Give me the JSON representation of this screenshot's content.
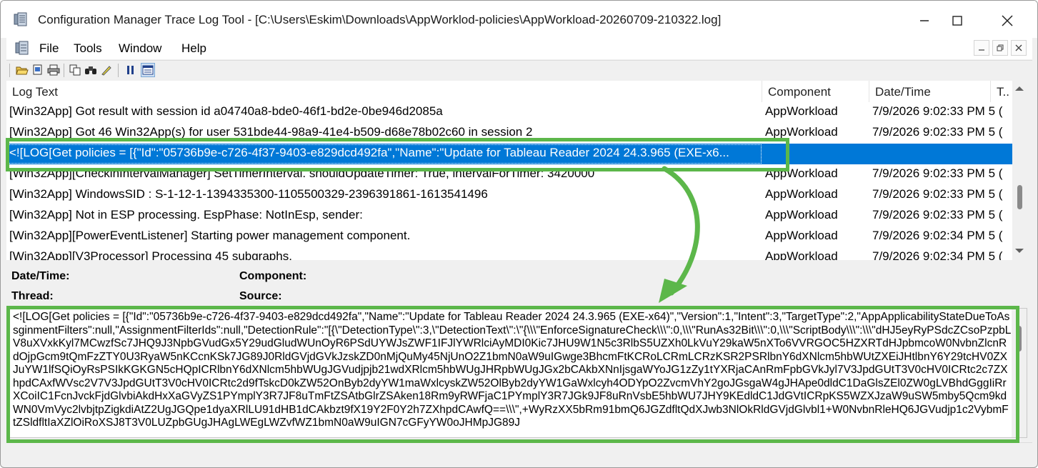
{
  "window": {
    "title": "Configuration Manager Trace Log Tool - [C:\\Users\\Eskim\\Downloads\\AppWorklod-policies\\AppWorkload-20260709-210322.log]"
  },
  "menu": {
    "items": [
      "File",
      "Tools",
      "Window",
      "Help"
    ]
  },
  "toolbar": {
    "buttons": [
      "open-icon",
      "print-preview-icon",
      "print-icon",
      "copy-icon",
      "find-icon",
      "highlight-icon",
      "pause-icon",
      "error-lookup-icon"
    ]
  },
  "columns": {
    "log_text": "Log Text",
    "component": "Component",
    "date_time": "Date/Time",
    "thread": "T.."
  },
  "rows": [
    {
      "text": "[Win32App] Got result with session id a04740a8-bde0-46f1-bd2e-0be946d2085a",
      "component": "AppWorkload",
      "date": "7/9/2026 9:02:33 PM",
      "thread": "5 ("
    },
    {
      "text": "[Win32App] Got 46 Win32App(s) for user 531bde44-98a9-41e4-b509-d68e78b02c60 in session 2",
      "component": "AppWorkload",
      "date": "7/9/2026 9:02:33 PM",
      "thread": "5 ("
    },
    {
      "text": "<![LOG[Get policies = [{\"Id\":\"05736b9e-c726-4f37-9403-e829dcd492fa\",\"Name\":\"Update for Tableau Reader 2024 24.3.965 (EXE-x6...",
      "component": "",
      "date": "",
      "thread": ""
    },
    {
      "text": "[Win32App][CheckinIntervalManager] SetTimerInterval. shouldUpdateTimer: True, intervalForTimer: 3420000",
      "component": "AppWorkload",
      "date": "7/9/2026 9:02:33 PM",
      "thread": "5 ("
    },
    {
      "text": "[Win32App] WindowsSID : S-1-12-1-1394335300-1105500329-2396391861-1613541496",
      "component": "AppWorkload",
      "date": "7/9/2026 9:02:33 PM",
      "thread": "5 ("
    },
    {
      "text": "[Win32App] Not in ESP processing. EspPhase: NotInEsp, sender:",
      "component": "AppWorkload",
      "date": "7/9/2026 9:02:33 PM",
      "thread": "5 ("
    },
    {
      "text": "[Win32App][PowerEventListener] Starting power management component.",
      "component": "AppWorkload",
      "date": "7/9/2026 9:02:34 PM",
      "thread": "5 ("
    },
    {
      "text": "[Win32App][V3Processor] Processing 45 subgraphs.",
      "component": "AppWorkload",
      "date": "7/9/2026 9:02:34 PM",
      "thread": "5 ("
    }
  ],
  "details": {
    "date_time_label": "Date/Time:",
    "component_label": "Component:",
    "thread_label": "Thread:",
    "source_label": "Source:"
  },
  "message": {
    "text": "<![LOG[Get policies = [{\"Id\":\"05736b9e-c726-4f37-9403-e829dcd492fa\",\"Name\":\"Update for Tableau Reader 2024 24.3.965 (EXE-x64)\",\"Version\":1,\"Intent\":3,\"TargetType\":2,\"AppApplicabilityStateDueToAssginmentFilters\":null,\"AssignmentFilterIds\":null,\"DetectionRule\":\"[{\\\"DetectionType\\\":3,\\\"DetectionText\\\":\\\"{\\\\\\\"EnforceSignatureCheck\\\\\\\":0,\\\\\\\"RunAs32Bit\\\\\\\":0,\\\\\\\"ScriptBody\\\\\\\":\\\\\\\"dHJ5eyRyPSdcZCsoPzpbLV8uXVxkKyl7MCwzfSc7JHQ9J3NpbGVudGx5Y29udGludWUnOyR6PSdUYWJsZWF1IFJlYWRlciAyMDI0Kic7JHU9W1N5c3RlbS5UZXh0LkVuY29kaW5nXTo6VVRGOC5HZXRTdHJpbmcoW0NvbnZlcnRdOjpGcm9tQmFzZTY0U3RyaW5nKCcnKSk7JG89J0RldGVjdGVkJzskZD0nMjQuMy45NjUnO2Z1bmN0aW9uIGwge3BhcmFtKCRoLCRmLCRzKSR2PSRlbnY6dXNlcm5hbWUtZXEiJHtlbnY6Y29tcHV0ZXJuYW1lfSQiOyRsPSIkKGKGN5cHQpICRlbnY6dXNlcm5hbWUgJGVudjpjb21wdXRlcm5hbWUgJHRpbWUgJGx2bCAkbXNnIjsgaWYoJG1zZy1tYXRjaCAnRmFpbGVkJyl7V3JpdGUtT3V0cHV0ICRtc2c7ZXhpdCAxfWVsc2V7V3JpdGUtT3V0cHV0ICRtc2d9fTskcD0kZW52OnByb2dyYW1maWxlcyskZW52OlByb2dyYW1GaWxlcyh4ODYpO2ZvcmVhY2goJGsgaW4gJHApe0dldC1DaGlsZEl0ZW0gLVBhdGggIiRrXCoiIC1FcnJvckFjdGlvbiAkdHxXaGVyZS1PYmplY3R7JF8uTmFtZSAtbGlrZSAken18Rm9yRWFjaC1PYmplY3R7JGk9JF8uRnVsbE5hbWU7JHY9KEdldC1JdGVtICRpKS5WZXJzaW9uSW5mby5Qcm9kdWN0VmVyc2lvbjtpZigkdiAtZ2UgJGQpe1dyaXRlLU91dHB1dCAkbzt9fX19Y2F0Y2h7ZXhpdCAwfQ==\\\\\\\",+WyRzXX5bRm91bmQ6JGZdfltQdXJwb3NlOkRldGVjdGlvbl1+W0NvbnRleHQ6JGVudjp1c2VybmFtZSldfltIaXZlOiRoXSJ8T3V0LUZpbGUgJHAgLWEgLWZvfWZ1bmN0aW9uIGN7cGFyYW0oJHMpJG89J"
  }
}
